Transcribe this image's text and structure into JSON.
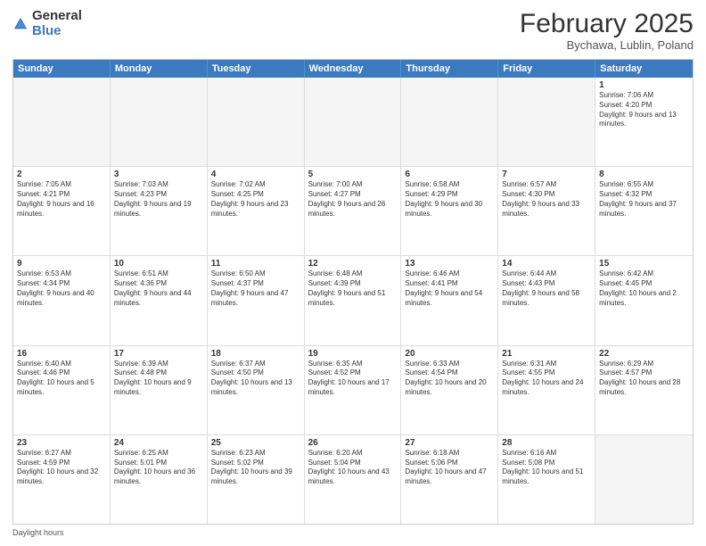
{
  "header": {
    "logo_general": "General",
    "logo_blue": "Blue",
    "month_title": "February 2025",
    "location": "Bychawa, Lublin, Poland"
  },
  "weekdays": [
    "Sunday",
    "Monday",
    "Tuesday",
    "Wednesday",
    "Thursday",
    "Friday",
    "Saturday"
  ],
  "weeks": [
    [
      {
        "day": "",
        "info": ""
      },
      {
        "day": "",
        "info": ""
      },
      {
        "day": "",
        "info": ""
      },
      {
        "day": "",
        "info": ""
      },
      {
        "day": "",
        "info": ""
      },
      {
        "day": "",
        "info": ""
      },
      {
        "day": "1",
        "info": "Sunrise: 7:06 AM\nSunset: 4:20 PM\nDaylight: 9 hours and 13 minutes."
      }
    ],
    [
      {
        "day": "2",
        "info": "Sunrise: 7:05 AM\nSunset: 4:21 PM\nDaylight: 9 hours and 16 minutes."
      },
      {
        "day": "3",
        "info": "Sunrise: 7:03 AM\nSunset: 4:23 PM\nDaylight: 9 hours and 19 minutes."
      },
      {
        "day": "4",
        "info": "Sunrise: 7:02 AM\nSunset: 4:25 PM\nDaylight: 9 hours and 23 minutes."
      },
      {
        "day": "5",
        "info": "Sunrise: 7:00 AM\nSunset: 4:27 PM\nDaylight: 9 hours and 26 minutes."
      },
      {
        "day": "6",
        "info": "Sunrise: 6:58 AM\nSunset: 4:29 PM\nDaylight: 9 hours and 30 minutes."
      },
      {
        "day": "7",
        "info": "Sunrise: 6:57 AM\nSunset: 4:30 PM\nDaylight: 9 hours and 33 minutes."
      },
      {
        "day": "8",
        "info": "Sunrise: 6:55 AM\nSunset: 4:32 PM\nDaylight: 9 hours and 37 minutes."
      }
    ],
    [
      {
        "day": "9",
        "info": "Sunrise: 6:53 AM\nSunset: 4:34 PM\nDaylight: 9 hours and 40 minutes."
      },
      {
        "day": "10",
        "info": "Sunrise: 6:51 AM\nSunset: 4:36 PM\nDaylight: 9 hours and 44 minutes."
      },
      {
        "day": "11",
        "info": "Sunrise: 6:50 AM\nSunset: 4:37 PM\nDaylight: 9 hours and 47 minutes."
      },
      {
        "day": "12",
        "info": "Sunrise: 6:48 AM\nSunset: 4:39 PM\nDaylight: 9 hours and 51 minutes."
      },
      {
        "day": "13",
        "info": "Sunrise: 6:46 AM\nSunset: 4:41 PM\nDaylight: 9 hours and 54 minutes."
      },
      {
        "day": "14",
        "info": "Sunrise: 6:44 AM\nSunset: 4:43 PM\nDaylight: 9 hours and 58 minutes."
      },
      {
        "day": "15",
        "info": "Sunrise: 6:42 AM\nSunset: 4:45 PM\nDaylight: 10 hours and 2 minutes."
      }
    ],
    [
      {
        "day": "16",
        "info": "Sunrise: 6:40 AM\nSunset: 4:46 PM\nDaylight: 10 hours and 5 minutes."
      },
      {
        "day": "17",
        "info": "Sunrise: 6:39 AM\nSunset: 4:48 PM\nDaylight: 10 hours and 9 minutes."
      },
      {
        "day": "18",
        "info": "Sunrise: 6:37 AM\nSunset: 4:50 PM\nDaylight: 10 hours and 13 minutes."
      },
      {
        "day": "19",
        "info": "Sunrise: 6:35 AM\nSunset: 4:52 PM\nDaylight: 10 hours and 17 minutes."
      },
      {
        "day": "20",
        "info": "Sunrise: 6:33 AM\nSunset: 4:54 PM\nDaylight: 10 hours and 20 minutes."
      },
      {
        "day": "21",
        "info": "Sunrise: 6:31 AM\nSunset: 4:55 PM\nDaylight: 10 hours and 24 minutes."
      },
      {
        "day": "22",
        "info": "Sunrise: 6:29 AM\nSunset: 4:57 PM\nDaylight: 10 hours and 28 minutes."
      }
    ],
    [
      {
        "day": "23",
        "info": "Sunrise: 6:27 AM\nSunset: 4:59 PM\nDaylight: 10 hours and 32 minutes."
      },
      {
        "day": "24",
        "info": "Sunrise: 6:25 AM\nSunset: 5:01 PM\nDaylight: 10 hours and 36 minutes."
      },
      {
        "day": "25",
        "info": "Sunrise: 6:23 AM\nSunset: 5:02 PM\nDaylight: 10 hours and 39 minutes."
      },
      {
        "day": "26",
        "info": "Sunrise: 6:20 AM\nSunset: 5:04 PM\nDaylight: 10 hours and 43 minutes."
      },
      {
        "day": "27",
        "info": "Sunrise: 6:18 AM\nSunset: 5:06 PM\nDaylight: 10 hours and 47 minutes."
      },
      {
        "day": "28",
        "info": "Sunrise: 6:16 AM\nSunset: 5:08 PM\nDaylight: 10 hours and 51 minutes."
      },
      {
        "day": "",
        "info": ""
      }
    ]
  ],
  "footer": "Daylight hours"
}
